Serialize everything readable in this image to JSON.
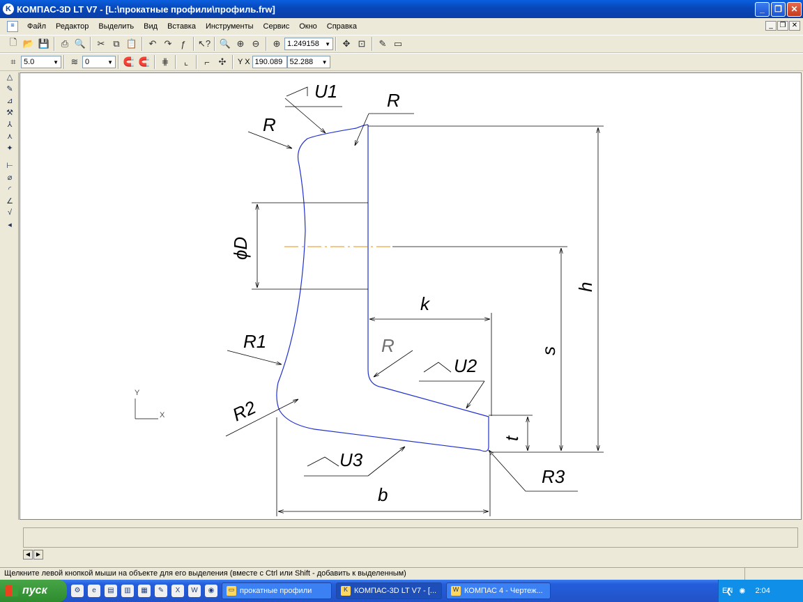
{
  "window": {
    "title": "КОМПАС-3D LT V7 - [L:\\прокатные профили\\профиль.frw]",
    "minimize": "_",
    "maximize": "❐",
    "close": "✕"
  },
  "menu": [
    "Файл",
    "Редактор",
    "Выделить",
    "Вид",
    "Вставка",
    "Инструменты",
    "Сервис",
    "Окно",
    "Справка"
  ],
  "toolbar": {
    "zoom_value": "1.249158",
    "scale_value": "5.0",
    "layer_value": "0",
    "coord_label": "Y X",
    "coord_x": "190.089",
    "coord_y": "52.288"
  },
  "drawing": {
    "labels": {
      "u1": "U1",
      "r_top_left": "R",
      "r_top_right": "R",
      "d": "ϕD",
      "h": "h",
      "k": "k",
      "r_inner": "R",
      "u2": "U2",
      "r1": "R1",
      "s": "s",
      "r2": "R2",
      "t": "t",
      "u3": "U3",
      "r3": "R3",
      "b": "b",
      "axis_y": "Y",
      "axis_x": "X"
    }
  },
  "status": {
    "hint": "Щелкните левой кнопкой мыши на объекте для его выделения (вместе с Ctrl или Shift - добавить к выделенным)"
  },
  "taskbar": {
    "start": "пуск",
    "tasks": [
      "прокатные профили",
      "КОМПАС-3D LT V7 - [...",
      "КОМПАС 4 - Чертеж..."
    ],
    "lang": "EN",
    "time": "2:04"
  }
}
